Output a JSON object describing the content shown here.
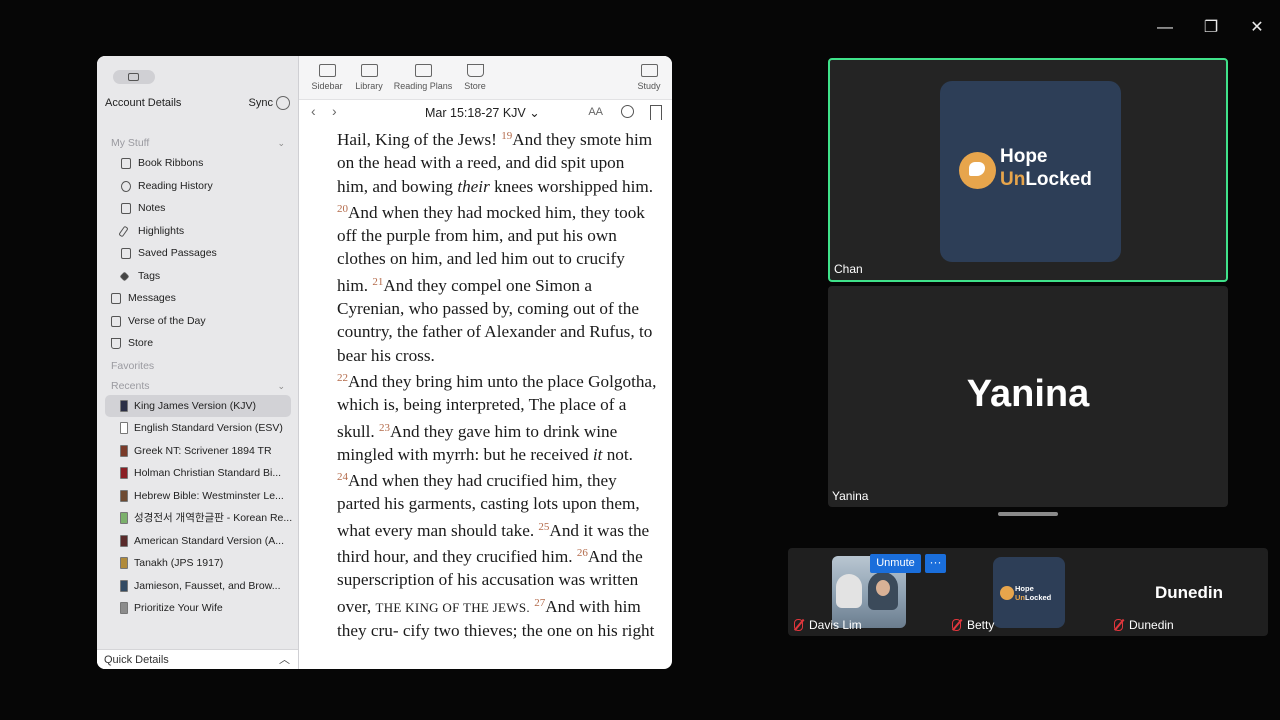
{
  "window_controls": {
    "minimize": "—",
    "restore": "❐",
    "close": "✕"
  },
  "app": {
    "sidebar": {
      "account_title": "Account Details",
      "sync_label": "Sync",
      "my_stuff_label": "My Stuff",
      "my_stuff_items": [
        "Book Ribbons",
        "Reading History",
        "Notes",
        "Highlights",
        "Saved Passages",
        "Tags"
      ],
      "top_items": [
        "Messages",
        "Verse of the Day",
        "Store"
      ],
      "favorites_label": "Favorites",
      "recents_label": "Recents",
      "recents": [
        {
          "label": "King James Version (KJV)",
          "color": "#2b2f45"
        },
        {
          "label": "English Standard Version (ESV)",
          "color": "#ffffff"
        },
        {
          "label": "Greek NT: Scrivener 1894 TR",
          "color": "#7a3b2a"
        },
        {
          "label": "Holman Christian Standard Bi...",
          "color": "#8a1f25"
        },
        {
          "label": "Hebrew Bible: Westminster Le...",
          "color": "#6d4a32"
        },
        {
          "label": "성경전서 개역한글판 - Korean Re...",
          "color": "#7bb06b"
        },
        {
          "label": "American Standard Version (A...",
          "color": "#5a2b2b"
        },
        {
          "label": "Tanakh (JPS 1917)",
          "color": "#b08a3a"
        },
        {
          "label": "Jamieson, Fausset, and Brow...",
          "color": "#334a62"
        },
        {
          "label": "Prioritize Your Wife",
          "color": "#8c8c8c"
        }
      ],
      "quick_details": "Quick Details"
    },
    "toolbar": {
      "sidebar": "Sidebar",
      "library": "Library",
      "reading_plans": "Reading Plans",
      "store": "Store",
      "study": "Study"
    },
    "nav": {
      "back": "‹",
      "forward": "›",
      "reference": "Mar 15:18-27 KJV",
      "font_size": "AA"
    },
    "verses": {
      "v18_tail": "Hail, King of the Jews!",
      "v19": "19",
      "v19_text_a": "And they smote him on the head with a reed, and did spit upon him, and bowing",
      "v19_italic": "their",
      "v19_text_b": "knees worshipped him.",
      "v20": "20",
      "v20_text": "And when they had mocked him, they took off the purple from him, and put his own clothes on him, and led him out to crucify him.",
      "v21": "21",
      "v21_text": "And they compel one Simon a Cyrenian, who passed by, coming out of the country, the father of Alexander and Rufus, to bear his cross.",
      "v22": "22",
      "v22_text": "And they bring him unto the place Golgotha, which is, being interpreted, The place of a skull.",
      "v23": "23",
      "v23_text_a": "And they gave him to drink wine mingled with myrrh: but he received",
      "v23_italic": "it",
      "v23_text_b": "not.",
      "v24": "24",
      "v24_text": "And when they had crucified him, they parted his garments, casting lots upon them, what every man should take.",
      "v25": "25",
      "v25_text": "And it was the third hour, and they crucified him.",
      "v26": "26",
      "v26_text_a": "And the superscription of his accusation was written over,",
      "v26_small_caps": "THE KING OF THE JEWS.",
      "v27": "27",
      "v27_text": "And with him they cru- cify two thieves; the one on his right"
    }
  },
  "zoom": {
    "tile_main": {
      "name": "Chan",
      "logo_line1": "Hope",
      "logo_un": "Un",
      "logo_rest": "Locked"
    },
    "tile_second": {
      "display_name": "Yanina",
      "name": "Yanina"
    },
    "strip": {
      "unmute": "Unmute",
      "more": "···",
      "logo_line1": "Hope",
      "logo_un": "Un",
      "logo_rest": "Locked",
      "davis": "Davis Lim",
      "betty": "Betty",
      "dunedin_big": "Dunedin",
      "dunedin": "Dunedin"
    }
  }
}
